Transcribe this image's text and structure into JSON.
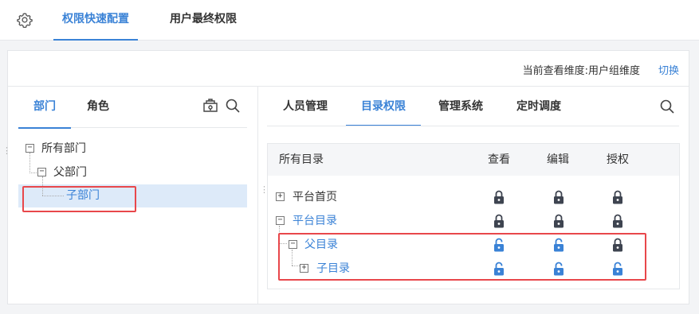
{
  "top_tabs": [
    {
      "label": "权限快速配置",
      "active": true
    },
    {
      "label": "用户最终权限",
      "active": false
    }
  ],
  "header": {
    "dimension_text": "当前查看维度:用户组维度",
    "switch_label": "切换"
  },
  "left_pane": {
    "tabs": [
      {
        "label": "部门",
        "active": true
      },
      {
        "label": "角色",
        "active": false
      }
    ],
    "tree": [
      {
        "label": "所有部门",
        "expander": "−",
        "selected": false
      },
      {
        "label": "父部门",
        "expander": "−",
        "selected": false
      },
      {
        "label": "子部门",
        "expander": "",
        "selected": true
      }
    ]
  },
  "right_pane": {
    "tabs": [
      {
        "label": "人员管理",
        "active": false
      },
      {
        "label": "目录权限",
        "active": true
      },
      {
        "label": "管理系统",
        "active": false
      },
      {
        "label": "定时调度",
        "active": false
      }
    ],
    "table": {
      "headers": [
        "所有目录",
        "查看",
        "编辑",
        "授权"
      ],
      "rows": [
        {
          "label": "平台首页",
          "expander": "+",
          "highlight": false,
          "view": "locked",
          "edit": "locked",
          "grant": "locked"
        },
        {
          "label": "平台目录",
          "expander": "−",
          "highlight": true,
          "view": "locked",
          "edit": "locked",
          "grant": "locked"
        },
        {
          "label": "父目录",
          "expander": "−",
          "highlight": true,
          "view": "unlocked",
          "edit": "unlocked",
          "grant": "locked"
        },
        {
          "label": "子目录",
          "expander": "+",
          "highlight": true,
          "view": "unlocked",
          "edit": "unlocked",
          "grant": "unlocked"
        }
      ]
    }
  },
  "colors": {
    "accent": "#3a82d6",
    "lock_dark": "#3e4450",
    "lock_open": "#3a82d6",
    "annotation_red": "#e8474b",
    "selected_row": "#ddeaf9"
  }
}
